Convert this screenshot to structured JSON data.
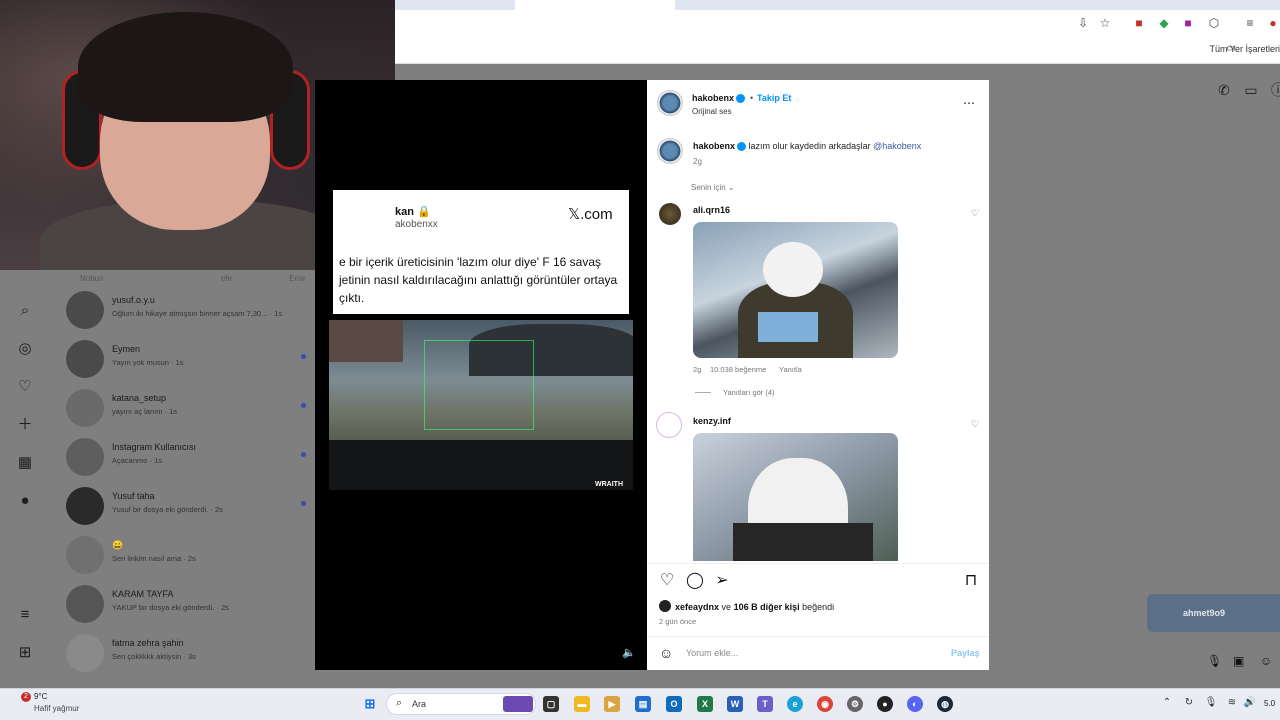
{
  "browser": {
    "bookmarks_label": "Tüm Yer İşaretleri"
  },
  "webcam": {},
  "left_nav": {
    "icons": [
      "search-icon",
      "compass-icon",
      "heart-icon",
      "plus-icon",
      "chart-icon",
      "avatar-icon",
      "menu-icon",
      "apps-icon"
    ]
  },
  "messages": {
    "top_labels": [
      "Nobun",
      "efe",
      "Emir"
    ],
    "items": [
      {
        "name": "yusuf.o.y.u",
        "text": "Oğlum iki hikaye atmışsın binner açsam 7,30... · 1s",
        "unread": false
      },
      {
        "name": "Eymen",
        "text": "Yayın yok musun · 1s",
        "unread": true
      },
      {
        "name": "katana_setup",
        "text": "yayını aç lanım · 1s",
        "unread": true
      },
      {
        "name": "Instagram Kullanıcısı",
        "text": "Açacanmo · 1s",
        "unread": true
      },
      {
        "name": "Yusuf taha",
        "text": "Yusuf bir dosya eki gönderdi. · 2s",
        "unread": true
      },
      {
        "name": "😄",
        "text": "Sen linkim nasıl ama · 2s",
        "unread": false
      },
      {
        "name": "KARAM TAYFA",
        "text": "YAKUP bir dosya eki gönderdi. · 2s",
        "unread": false
      },
      {
        "name": "fatma zehra şahin",
        "text": "Sen çokkkkk aktiysin · 3s",
        "unread": false
      }
    ]
  },
  "video": {
    "tweet": {
      "name_partial": "kan 🔒",
      "handle_partial": "akobenxx",
      "source": "𝕏.com",
      "text": "e bir içerik üreticisinin 'lazım olur diye' F 16 savaş jetinin nasıl kaldırılacağını anlattığı görüntüler ortaya çıktı."
    },
    "game_brand": "WRAITH"
  },
  "post": {
    "author": "hakobenx",
    "follow": "Takip Et",
    "audio": "Orijinal ses",
    "caption_author": "hakobenx",
    "caption_text": "lazım olur kaydedin arkadaşlar",
    "caption_mention": "@hakobenx",
    "caption_time": "2g",
    "sort_label": "Senin için",
    "comments": [
      {
        "user": "ali.qrn16",
        "time": "2g",
        "likes": "10.038 beğenme",
        "reply": "Yanıtla",
        "replies": "Yanıtları gör (4)"
      },
      {
        "user": "kenzy.inf"
      }
    ],
    "liked_by_user": "xefeaydnx",
    "liked_by_connector": "ve",
    "liked_by_others": "106 B diğer kişi",
    "liked_by_suffix": "beğendi",
    "post_time": "2 gün önce",
    "comment_placeholder": "Yorum ekle...",
    "share_label": "Paylaş"
  },
  "right_panel": {
    "caller_name": "ahmet9o9"
  },
  "taskbar": {
    "weather_badge": "2",
    "weather_temp": "9°C",
    "weather_desc": "Hafif yağmur",
    "search_label": "Ara",
    "clock_partial": "5.0"
  }
}
